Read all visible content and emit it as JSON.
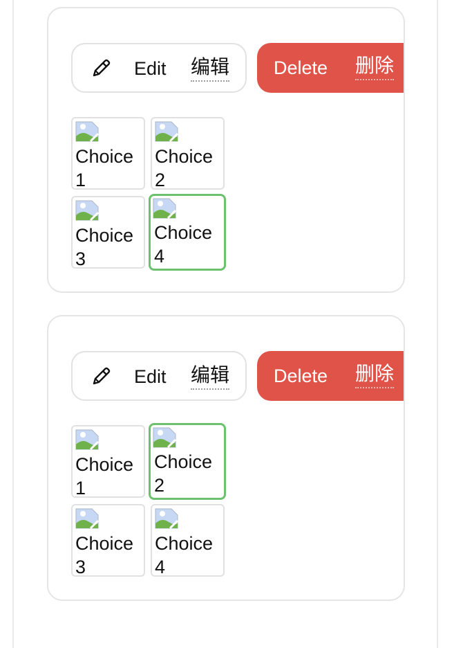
{
  "questions": [
    {
      "edit_label": "Edit",
      "edit_label_cn": "编辑",
      "delete_label": "Delete",
      "delete_label_cn": "删除",
      "selected_choice": "Choice 4",
      "choices": [
        {
          "label": "Choice 1"
        },
        {
          "label": "Choice 2"
        },
        {
          "label": "Choice 3"
        },
        {
          "label": "Choice 4"
        }
      ]
    },
    {
      "edit_label": "Edit",
      "edit_label_cn": "编辑",
      "delete_label": "Delete",
      "delete_label_cn": "删除",
      "selected_choice": "Choice 2",
      "choices": [
        {
          "label": "Choice 1"
        },
        {
          "label": "Choice 2"
        },
        {
          "label": "Choice 3"
        },
        {
          "label": "Choice 4"
        }
      ]
    }
  ],
  "icons": {
    "edit": "pencil-icon",
    "choice_image": "broken-image-icon"
  },
  "colors": {
    "delete_bg": "#df5349",
    "selected_border": "#6cc06e"
  }
}
